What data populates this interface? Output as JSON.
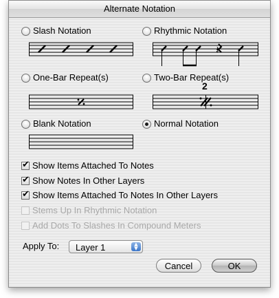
{
  "dialog": {
    "title": "Alternate Notation"
  },
  "options": {
    "slash": {
      "label": "Slash Notation",
      "selected": false
    },
    "rhythmic": {
      "label": "Rhythmic Notation",
      "selected": false
    },
    "one_bar": {
      "label": "One-Bar Repeat(s)",
      "selected": false
    },
    "two_bar": {
      "label": "Two-Bar Repeat(s)",
      "selected": false,
      "number": "2"
    },
    "blank": {
      "label": "Blank Notation",
      "selected": false
    },
    "normal": {
      "label": "Normal Notation",
      "selected": true
    }
  },
  "checkboxes": {
    "attached": {
      "label": "Show Items Attached To Notes",
      "checked": true,
      "enabled": true
    },
    "other_layers": {
      "label": "Show Notes In Other Layers",
      "checked": true,
      "enabled": true
    },
    "attached_other": {
      "label": "Show Items Attached To Notes In Other Layers",
      "checked": true,
      "enabled": true
    },
    "stems_up": {
      "label": "Stems Up In Rhythmic Notation",
      "checked": false,
      "enabled": false
    },
    "add_dots": {
      "label": "Add Dots To Slashes In Compound Meters",
      "checked": false,
      "enabled": false
    }
  },
  "apply_to": {
    "label": "Apply To:",
    "value": "Layer 1"
  },
  "buttons": {
    "cancel": "Cancel",
    "ok": "OK"
  }
}
